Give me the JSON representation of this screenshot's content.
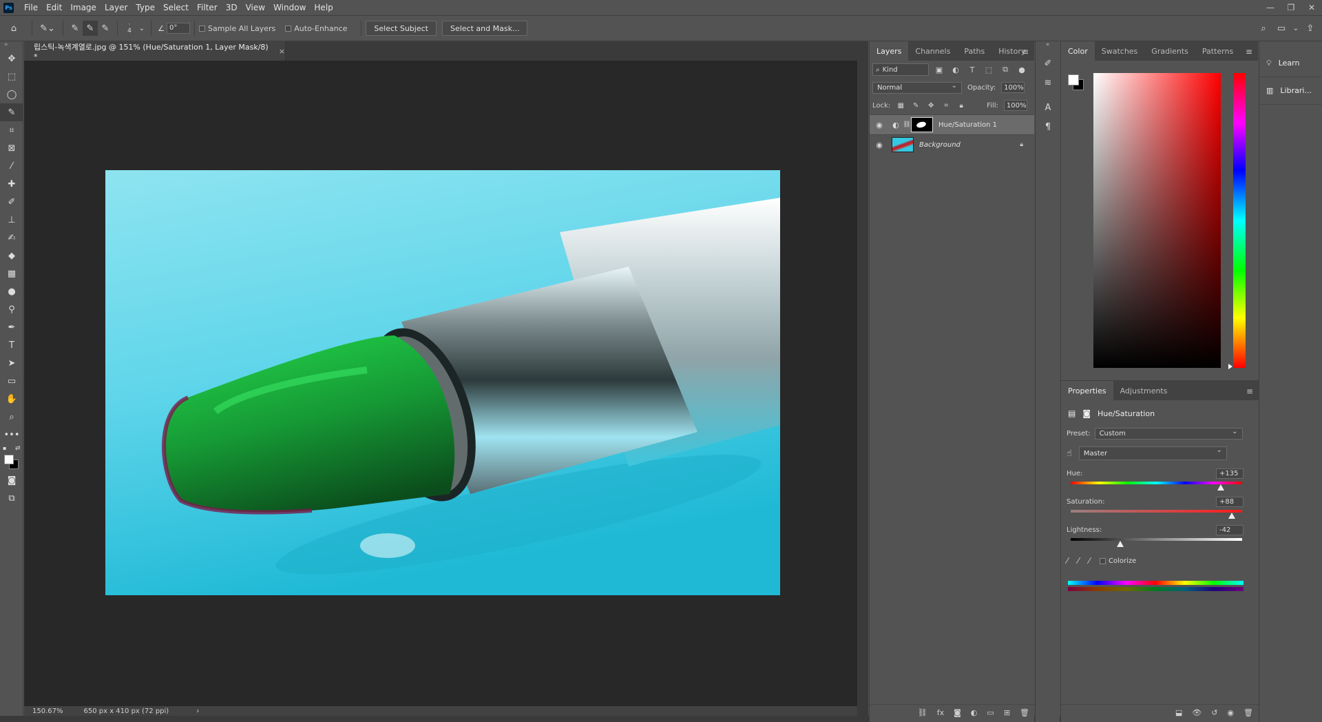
{
  "app": {
    "logo": "Ps"
  },
  "menu": [
    "File",
    "Edit",
    "Image",
    "Layer",
    "Type",
    "Select",
    "Filter",
    "3D",
    "View",
    "Window",
    "Help"
  ],
  "window_controls": {
    "minimize": "—",
    "restore": "❐",
    "close": "✕"
  },
  "options": {
    "brush_size": "4",
    "angle_value": "0°",
    "sample_all_layers": "Sample All Layers",
    "auto_enhance": "Auto-Enhance",
    "select_subject": "Select Subject",
    "select_and_mask": "Select and Mask..."
  },
  "document": {
    "tab_title": "립스틱-녹색계열로.jpg @ 151% (Hue/Saturation 1, Layer Mask/8) *",
    "zoom": "150.67%",
    "size_info": "650 px x 410 px (72 ppi)"
  },
  "layers_panel": {
    "tabs": [
      "Layers",
      "Channels",
      "Paths",
      "History"
    ],
    "kind_filter": "Kind",
    "blend_mode": "Normal",
    "opacity_label": "Opacity:",
    "opacity": "100%",
    "lock_label": "Lock:",
    "fill_label": "Fill:",
    "fill": "100%",
    "layers": [
      {
        "name": "Hue/Saturation 1",
        "selected": true
      },
      {
        "name": "Background",
        "selected": false
      }
    ]
  },
  "color_panel": {
    "tabs": [
      "Color",
      "Swatches",
      "Gradients",
      "Patterns"
    ],
    "foreground": "#ffffff",
    "background": "#000000"
  },
  "properties": {
    "tabs": [
      "Properties",
      "Adjustments"
    ],
    "title": "Hue/Saturation",
    "preset_label": "Preset:",
    "preset": "Custom",
    "channel": "Master",
    "hue_label": "Hue:",
    "hue": "+135",
    "hue_pos": 0.875,
    "saturation_label": "Saturation:",
    "saturation": "+88",
    "saturation_pos": 0.94,
    "lightness_label": "Lightness:",
    "lightness": "-42",
    "lightness_pos": 0.29,
    "colorize": "Colorize"
  },
  "side": {
    "learn": "Learn",
    "libraries": "Librari..."
  }
}
